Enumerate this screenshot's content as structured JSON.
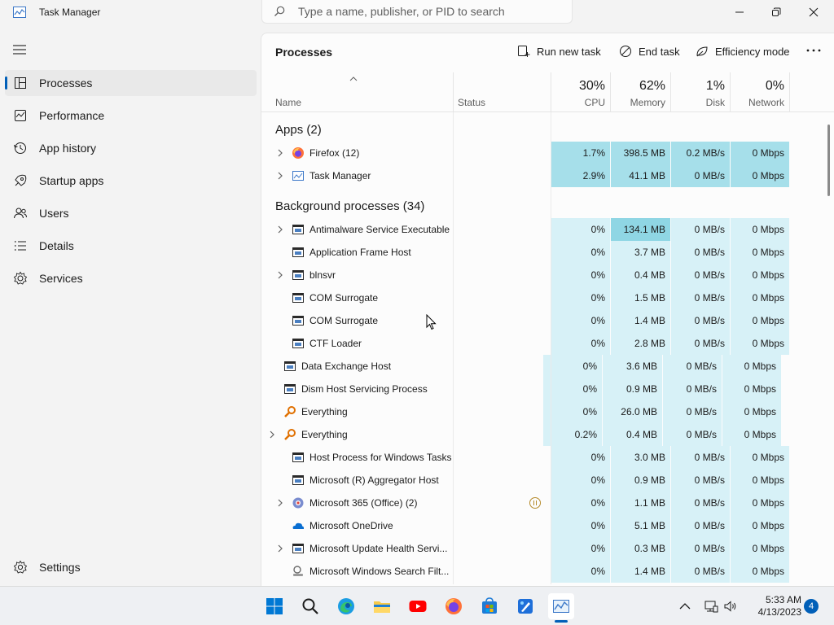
{
  "window": {
    "title": "Task Manager"
  },
  "search": {
    "placeholder": "Type a name, publisher, or PID to search"
  },
  "sidebar": {
    "items": [
      {
        "label": "Processes",
        "icon": "processes-icon"
      },
      {
        "label": "Performance",
        "icon": "performance-icon"
      },
      {
        "label": "App history",
        "icon": "app-history-icon"
      },
      {
        "label": "Startup apps",
        "icon": "startup-icon"
      },
      {
        "label": "Users",
        "icon": "users-icon"
      },
      {
        "label": "Details",
        "icon": "details-icon"
      },
      {
        "label": "Services",
        "icon": "services-icon"
      }
    ],
    "settings_label": "Settings"
  },
  "toolbar": {
    "title": "Processes",
    "run_new_task": "Run new task",
    "end_task": "End task",
    "efficiency_mode": "Efficiency mode"
  },
  "columns": {
    "name": "Name",
    "status": "Status",
    "cpu_pct": "30%",
    "cpu": "CPU",
    "memory_pct": "62%",
    "memory": "Memory",
    "disk_pct": "1%",
    "disk": "Disk",
    "network_pct": "0%",
    "network": "Network"
  },
  "groups": {
    "apps": "Apps (2)",
    "background": "Background processes (34)"
  },
  "apps": [
    {
      "name": "Firefox (12)",
      "cpu": "1.7%",
      "memory": "398.5 MB",
      "disk": "0.2 MB/s",
      "network": "0 Mbps",
      "expandable": true,
      "icon": "firefox-icon"
    },
    {
      "name": "Task Manager",
      "cpu": "2.9%",
      "memory": "41.1 MB",
      "disk": "0 MB/s",
      "network": "0 Mbps",
      "expandable": true,
      "icon": "task-manager-icon"
    }
  ],
  "background": [
    {
      "name": "Antimalware Service Executable",
      "cpu": "0%",
      "memory": "134.1 MB",
      "disk": "0 MB/s",
      "network": "0 Mbps",
      "expandable": true,
      "icon": "process-window-icon"
    },
    {
      "name": "Application Frame Host",
      "cpu": "0%",
      "memory": "3.7 MB",
      "disk": "0 MB/s",
      "network": "0 Mbps",
      "expandable": false,
      "icon": "process-window-icon"
    },
    {
      "name": "blnsvr",
      "cpu": "0%",
      "memory": "0.4 MB",
      "disk": "0 MB/s",
      "network": "0 Mbps",
      "expandable": true,
      "icon": "process-window-icon"
    },
    {
      "name": "COM Surrogate",
      "cpu": "0%",
      "memory": "1.5 MB",
      "disk": "0 MB/s",
      "network": "0 Mbps",
      "expandable": false,
      "icon": "process-window-icon"
    },
    {
      "name": "COM Surrogate",
      "cpu": "0%",
      "memory": "1.4 MB",
      "disk": "0 MB/s",
      "network": "0 Mbps",
      "expandable": false,
      "icon": "process-window-icon"
    },
    {
      "name": "CTF Loader",
      "cpu": "0%",
      "memory": "2.8 MB",
      "disk": "0 MB/s",
      "network": "0 Mbps",
      "expandable": false,
      "icon": "process-window-icon"
    },
    {
      "name": "Data Exchange Host",
      "cpu": "0%",
      "memory": "3.6 MB",
      "disk": "0 MB/s",
      "network": "0 Mbps",
      "expandable": false,
      "icon": "process-window-icon"
    },
    {
      "name": "Dism Host Servicing Process",
      "cpu": "0%",
      "memory": "0.9 MB",
      "disk": "0 MB/s",
      "network": "0 Mbps",
      "expandable": false,
      "icon": "process-window-icon"
    },
    {
      "name": "Everything",
      "cpu": "0%",
      "memory": "26.0 MB",
      "disk": "0 MB/s",
      "network": "0 Mbps",
      "expandable": false,
      "icon": "everything-icon"
    },
    {
      "name": "Everything",
      "cpu": "0.2%",
      "memory": "0.4 MB",
      "disk": "0 MB/s",
      "network": "0 Mbps",
      "expandable": true,
      "icon": "everything-icon"
    },
    {
      "name": "Host Process for Windows Tasks",
      "cpu": "0%",
      "memory": "3.0 MB",
      "disk": "0 MB/s",
      "network": "0 Mbps",
      "expandable": false,
      "icon": "process-window-icon"
    },
    {
      "name": "Microsoft (R) Aggregator Host",
      "cpu": "0%",
      "memory": "0.9 MB",
      "disk": "0 MB/s",
      "network": "0 Mbps",
      "expandable": false,
      "icon": "process-window-icon"
    },
    {
      "name": "Microsoft 365 (Office) (2)",
      "cpu": "0%",
      "memory": "1.1 MB",
      "disk": "0 MB/s",
      "network": "0 Mbps",
      "expandable": true,
      "icon": "office-icon",
      "status_icon": "paused-icon"
    },
    {
      "name": "Microsoft OneDrive",
      "cpu": "0%",
      "memory": "5.1 MB",
      "disk": "0 MB/s",
      "network": "0 Mbps",
      "expandable": false,
      "icon": "onedrive-icon"
    },
    {
      "name": "Microsoft Update Health Servi...",
      "cpu": "0%",
      "memory": "0.3 MB",
      "disk": "0 MB/s",
      "network": "0 Mbps",
      "expandable": true,
      "icon": "process-window-icon"
    },
    {
      "name": "Microsoft Windows Search Filt...",
      "cpu": "0%",
      "memory": "1.4 MB",
      "disk": "0 MB/s",
      "network": "0 Mbps",
      "expandable": false,
      "icon": "search-filter-icon"
    }
  ],
  "taskbar": {
    "apps": [
      "start-icon",
      "search-icon",
      "edge-icon",
      "file-explorer-icon",
      "youtube-icon",
      "firefox-icon",
      "store-icon",
      "paint-icon",
      "task-manager-icon"
    ],
    "time": "5:33 AM",
    "date": "4/13/2023",
    "notification_count": "4"
  },
  "colors": {
    "accent": "#005fb8",
    "heat_light": "#d7f1f7",
    "heat_mid": "#a6dfea",
    "heat_strong": "#8fd6e4"
  }
}
